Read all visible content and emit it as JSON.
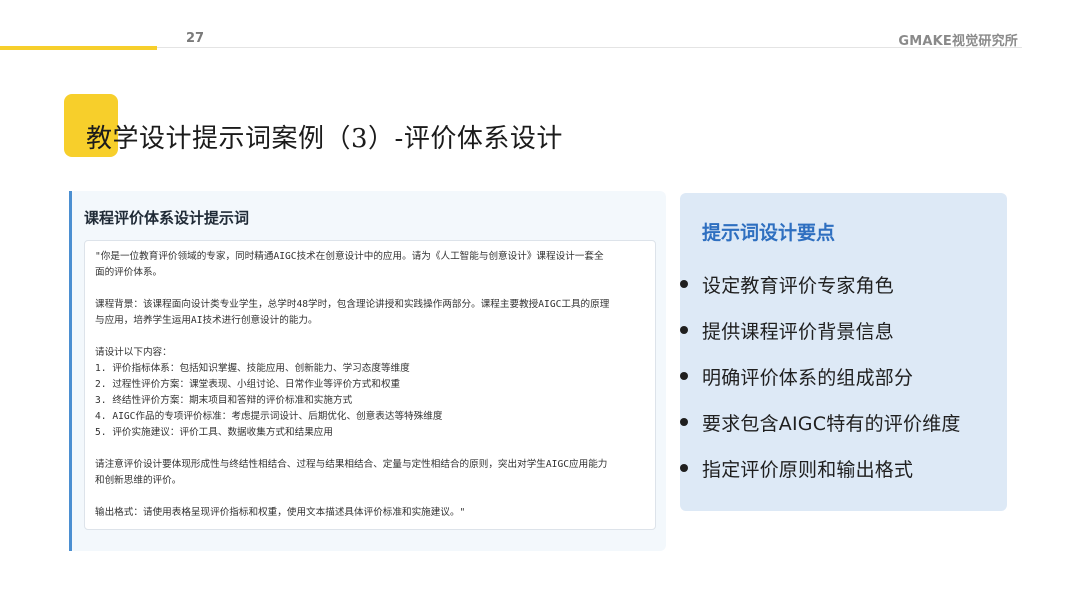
{
  "header": {
    "page_number": "27",
    "brand": "GMAKE视觉研究所",
    "accent_color": "#f7cf2b"
  },
  "title": "教学设计提示词案例（3）-评价体系设计",
  "left_card": {
    "title": "课程评价体系设计提示词",
    "accent_color": "#4b8fd1",
    "paragraphs": [
      [
        "\"你是一位教育评价领域的专家，同时精通AIGC技术在创意设计中的应用。请为《人工智能与创意设计》课程设计一套全",
        "面的评价体系。"
      ],
      [
        "课程背景：该课程面向设计类专业学生，总学时48学时，包含理论讲授和实践操作两部分。课程主要教授AIGC工具的原理",
        "与应用，培养学生运用AI技术进行创意设计的能力。"
      ],
      [
        "请设计以下内容：",
        "1. 评价指标体系：包括知识掌握、技能应用、创新能力、学习态度等维度",
        "2. 过程性评价方案：课堂表现、小组讨论、日常作业等评价方式和权重",
        "3. 终结性评价方案：期末项目和答辩的评价标准和实施方式",
        "4. AIGC作品的专项评价标准：考虑提示词设计、后期优化、创意表达等特殊维度",
        "5. 评价实施建议：评价工具、数据收集方式和结果应用"
      ],
      [
        "请注意评价设计要体现形成性与终结性相结合、过程与结果相结合、定量与定性相结合的原则，突出对学生AIGC应用能力",
        "和创新思维的评价。"
      ],
      [
        "输出格式：请使用表格呈现评价指标和权重，使用文本描述具体评价标准和实施建议。\""
      ]
    ]
  },
  "right_card": {
    "title": "提示词设计要点",
    "title_color": "#2e6fc0",
    "bullets": [
      "设定教育评价专家角色",
      "提供课程评价背景信息",
      "明确评价体系的组成部分",
      "要求包含AIGC特有的评价维度",
      "指定评价原则和输出格式"
    ]
  }
}
